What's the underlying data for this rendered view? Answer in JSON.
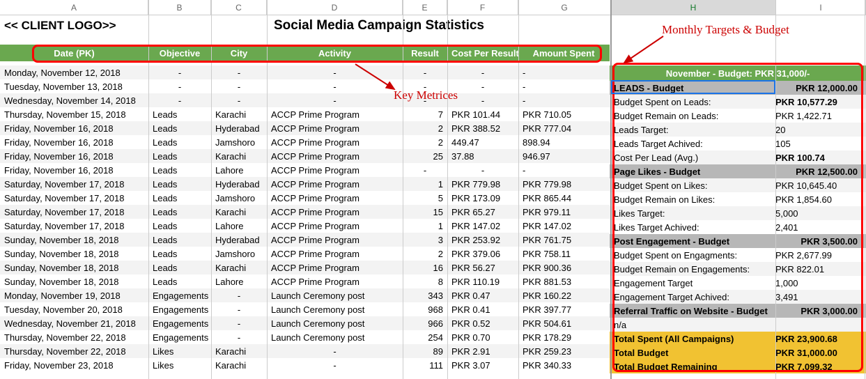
{
  "col_headers": [
    "A",
    "B",
    "C",
    "D",
    "E",
    "F",
    "G",
    "H",
    "I"
  ],
  "title_left": "<< CLIENT LOGO>>",
  "title_main": "Social Media Campaign Statistics",
  "annotations": {
    "key_metrices": "Key Metrices",
    "monthly_targets": "Monthly Targets & Budget"
  },
  "table_headers": {
    "date": "Date (PK)",
    "objective": "Objective",
    "city": "City",
    "activity": "Activity",
    "result": "Result",
    "cost": "Cost Per Result",
    "amount": "Amount Spent"
  },
  "rows": [
    {
      "date": "Monday, November 12, 2018",
      "objective": "-",
      "city": "-",
      "activity": "-",
      "result": "-",
      "cost": "-",
      "amount": "-"
    },
    {
      "date": "Tuesday, November 13, 2018",
      "objective": "-",
      "city": "-",
      "activity": "-",
      "result": "-",
      "cost": "-",
      "amount": "-"
    },
    {
      "date": "Wednesday, November 14, 2018",
      "objective": "-",
      "city": "-",
      "activity": "-",
      "result": "-",
      "cost": "-",
      "amount": "-"
    },
    {
      "date": "Thursday, November 15, 2018",
      "objective": "Leads",
      "city": "Karachi",
      "activity": "ACCP Prime Program",
      "result": "7",
      "cost": "PKR 101.44",
      "amount": "PKR 710.05"
    },
    {
      "date": "Friday, November 16, 2018",
      "objective": "Leads",
      "city": "Hyderabad",
      "activity": "ACCP Prime Program",
      "result": "2",
      "cost": "PKR 388.52",
      "amount": "PKR 777.04"
    },
    {
      "date": "Friday, November 16, 2018",
      "objective": "Leads",
      "city": "Jamshoro",
      "activity": "ACCP Prime Program",
      "result": "2",
      "cost": "449.47",
      "amount": "898.94"
    },
    {
      "date": "Friday, November 16, 2018",
      "objective": "Leads",
      "city": "Karachi",
      "activity": "ACCP Prime Program",
      "result": "25",
      "cost": "37.88",
      "amount": "946.97"
    },
    {
      "date": "Friday, November 16, 2018",
      "objective": "Leads",
      "city": "Lahore",
      "activity": "ACCP Prime Program",
      "result": "-",
      "cost": "-",
      "amount": "-"
    },
    {
      "date": "Saturday, November 17, 2018",
      "objective": "Leads",
      "city": "Hyderabad",
      "activity": "ACCP Prime Program",
      "result": "1",
      "cost": "PKR 779.98",
      "amount": "PKR 779.98"
    },
    {
      "date": "Saturday, November 17, 2018",
      "objective": "Leads",
      "city": "Jamshoro",
      "activity": "ACCP Prime Program",
      "result": "5",
      "cost": "PKR 173.09",
      "amount": "PKR 865.44"
    },
    {
      "date": "Saturday, November 17, 2018",
      "objective": "Leads",
      "city": "Karachi",
      "activity": "ACCP Prime Program",
      "result": "15",
      "cost": "PKR 65.27",
      "amount": "PKR 979.11"
    },
    {
      "date": "Saturday, November 17, 2018",
      "objective": "Leads",
      "city": "Lahore",
      "activity": "ACCP Prime Program",
      "result": "1",
      "cost": "PKR 147.02",
      "amount": "PKR 147.02"
    },
    {
      "date": "Sunday, November 18, 2018",
      "objective": "Leads",
      "city": "Hyderabad",
      "activity": "ACCP Prime Program",
      "result": "3",
      "cost": "PKR 253.92",
      "amount": "PKR 761.75"
    },
    {
      "date": "Sunday, November 18, 2018",
      "objective": "Leads",
      "city": "Jamshoro",
      "activity": "ACCP Prime Program",
      "result": "2",
      "cost": "PKR 379.06",
      "amount": "PKR 758.11"
    },
    {
      "date": "Sunday, November 18, 2018",
      "objective": "Leads",
      "city": "Karachi",
      "activity": "ACCP Prime Program",
      "result": "16",
      "cost": "PKR 56.27",
      "amount": "PKR 900.36"
    },
    {
      "date": "Sunday, November 18, 2018",
      "objective": "Leads",
      "city": "Lahore",
      "activity": "ACCP Prime Program",
      "result": "8",
      "cost": "PKR 110.19",
      "amount": "PKR 881.53"
    },
    {
      "date": "Monday, November 19, 2018",
      "objective": "Engagements",
      "city": "-",
      "activity": "Launch Ceremony post",
      "result": "343",
      "cost": "PKR 0.47",
      "amount": "PKR 160.22"
    },
    {
      "date": "Tuesday, November 20, 2018",
      "objective": "Engagements",
      "city": "-",
      "activity": "Launch Ceremony post",
      "result": "968",
      "cost": "PKR 0.41",
      "amount": "PKR 397.77"
    },
    {
      "date": "Wednesday, November 21, 2018",
      "objective": "Engagements",
      "city": "-",
      "activity": "Launch Ceremony post",
      "result": "966",
      "cost": "PKR 0.52",
      "amount": "PKR 504.61"
    },
    {
      "date": "Thursday, November 22, 2018",
      "objective": "Engagements",
      "city": "-",
      "activity": "Launch Ceremony post",
      "result": "254",
      "cost": "PKR 0.70",
      "amount": "PKR 178.29"
    },
    {
      "date": "Thursday, November 22, 2018",
      "objective": "Likes",
      "city": "Karachi",
      "activity": "-",
      "result": "89",
      "cost": "PKR 2.91",
      "amount": "PKR 259.23"
    },
    {
      "date": "Friday, November 23, 2018",
      "objective": "Likes",
      "city": "Karachi",
      "activity": "-",
      "result": "111",
      "cost": "PKR 3.07",
      "amount": "PKR 340.33"
    }
  ],
  "budget": {
    "title": "November - Budget: PKR 31,000/-",
    "sections": [
      {
        "label": "LEADS - Budget",
        "value": "PKR 12,000.00",
        "type": "section"
      },
      {
        "label": "Budget Spent on Leads:",
        "value": "PKR 10,577.29",
        "type": "row",
        "bold": true
      },
      {
        "label": "Budget Remain on Leads:",
        "value": "PKR 1,422.71",
        "type": "row"
      },
      {
        "label": "Leads Target:",
        "value": "20",
        "type": "row"
      },
      {
        "label": "Leads Target Achived:",
        "value": "105",
        "type": "row"
      },
      {
        "label": "Cost Per Lead (Avg.)",
        "value": "PKR 100.74",
        "type": "row",
        "bold": true
      },
      {
        "label": "Page Likes - Budget",
        "value": "PKR 12,500.00",
        "type": "section"
      },
      {
        "label": "Budget Spent on Likes:",
        "value": "PKR 10,645.40",
        "type": "row"
      },
      {
        "label": "Budget Remain on Likes:",
        "value": "PKR 1,854.60",
        "type": "row"
      },
      {
        "label": "Likes Target:",
        "value": "5,000",
        "type": "row"
      },
      {
        "label": "Likes Target Achived:",
        "value": "2,401",
        "type": "row"
      },
      {
        "label": "Post Engagement - Budget",
        "value": "PKR 3,500.00",
        "type": "section"
      },
      {
        "label": "Budget Spent on Engagments:",
        "value": "PKR 2,677.99",
        "type": "row"
      },
      {
        "label": "Budget Remain on Engagements:",
        "value": "PKR 822.01",
        "type": "row"
      },
      {
        "label": "Engagement Target",
        "value": "1,000",
        "type": "row"
      },
      {
        "label": "Engagement Target Achived:",
        "value": "3,491",
        "type": "row"
      },
      {
        "label": "Referral Traffic on Website - Budget",
        "value": "PKR 3,000.00",
        "type": "section"
      },
      {
        "label": "n/a",
        "value": "",
        "type": "row"
      },
      {
        "label": "Total Spent (All Campaigns)",
        "value": "PKR 23,900.68",
        "type": "total"
      },
      {
        "label": "Total Budget",
        "value": "PKR 31,000.00",
        "type": "total"
      },
      {
        "label": "Total Budget Remaining",
        "value": "PKR 7,099.32",
        "type": "total"
      }
    ]
  }
}
